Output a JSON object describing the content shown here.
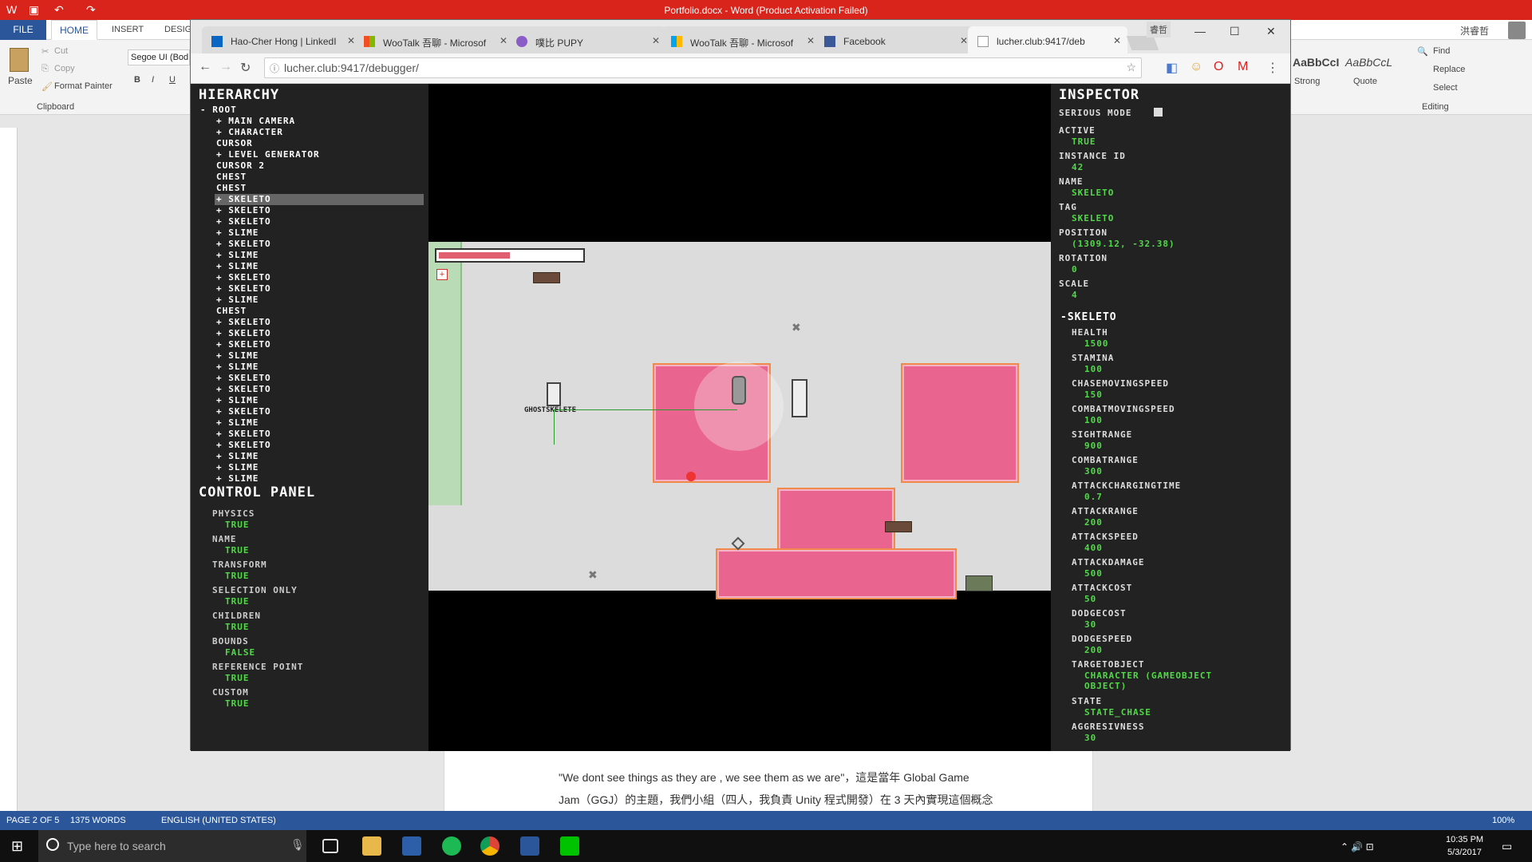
{
  "word": {
    "title": "Portfolio.docx - Word (Product Activation Failed)",
    "tabs": [
      "FILE",
      "HOME",
      "INSERT",
      "DESIG"
    ],
    "clipboard": {
      "paste": "Paste",
      "cut": "Cut",
      "copy": "Copy",
      "format_painter": "Format Painter",
      "group": "Clipboard"
    },
    "font_name": "Segoe UI (Bod",
    "styles": [
      {
        "sample": "AaBbCcI",
        "name": "Strong"
      },
      {
        "sample": "AaBbCcL",
        "name": "Quote"
      }
    ],
    "editing": {
      "find": "Find",
      "replace": "Replace",
      "select": "Select",
      "group": "Editing"
    },
    "user": "洪睿哲",
    "doc_lines": [
      "\"We dont see things as they are , we see them as we are\"，這是當年 Global Game",
      "Jam（GGJ）的主題，我們小組（四人，我負責 Unity 程式開發）在 3 天內實現這個概念"
    ],
    "status": {
      "page": "PAGE 2 OF 5",
      "words": "1375 WORDS",
      "language": "ENGLISH (UNITED STATES)",
      "zoom": "100%"
    }
  },
  "chrome": {
    "tabs": [
      {
        "title": "Hao-Cher Hong | LinkedI",
        "icon": "linkedin-icon"
      },
      {
        "title": "WooTalk 吾聊 - Microsof",
        "icon": "microsoft-icon"
      },
      {
        "title": "噗比 PUPY",
        "icon": "pupy-icon"
      },
      {
        "title": "WooTalk 吾聊 - Microsof",
        "icon": "microsoft-icon"
      },
      {
        "title": "Facebook",
        "icon": "facebook-icon"
      },
      {
        "title": "lucher.club:9417/deb",
        "icon": "page-icon"
      }
    ],
    "profile_label": "睿哲",
    "url": "lucher.club:9417/debugger/"
  },
  "hierarchy": {
    "title": "Hierarchy",
    "root": "- Root",
    "items": [
      {
        "label": "+ Main Camera",
        "selected": false
      },
      {
        "label": "+ Character",
        "selected": false
      },
      {
        "label": "Cursor",
        "selected": false
      },
      {
        "label": "+ Level Generator",
        "selected": false
      },
      {
        "label": "Cursor 2",
        "selected": false
      },
      {
        "label": "Chest",
        "selected": false
      },
      {
        "label": "Chest",
        "selected": false
      },
      {
        "label": "+ Skeleto",
        "selected": true
      },
      {
        "label": "+ Skeleto",
        "selected": false
      },
      {
        "label": "+ Skeleto",
        "selected": false
      },
      {
        "label": "+ Slime",
        "selected": false
      },
      {
        "label": "+ Skeleto",
        "selected": false
      },
      {
        "label": "+ Slime",
        "selected": false
      },
      {
        "label": "+ Slime",
        "selected": false
      },
      {
        "label": "+ Skeleto",
        "selected": false
      },
      {
        "label": "+ Skeleto",
        "selected": false
      },
      {
        "label": "+ Slime",
        "selected": false
      },
      {
        "label": "Chest",
        "selected": false
      },
      {
        "label": "+ Skeleto",
        "selected": false
      },
      {
        "label": "+ Skeleto",
        "selected": false
      },
      {
        "label": "+ Skeleto",
        "selected": false
      },
      {
        "label": "+ Slime",
        "selected": false
      },
      {
        "label": "+ Slime",
        "selected": false
      },
      {
        "label": "+ Skeleto",
        "selected": false
      },
      {
        "label": "+ Skeleto",
        "selected": false
      },
      {
        "label": "+ Slime",
        "selected": false
      },
      {
        "label": "+ Skeleto",
        "selected": false
      },
      {
        "label": "+ Slime",
        "selected": false
      },
      {
        "label": "+ Skeleto",
        "selected": false
      },
      {
        "label": "+ Skeleto",
        "selected": false
      },
      {
        "label": "+ Slime",
        "selected": false
      },
      {
        "label": "+ Slime",
        "selected": false
      },
      {
        "label": "+ Slime",
        "selected": false
      }
    ]
  },
  "control_panel": {
    "title": "Control Panel",
    "items": [
      {
        "label": "Physics",
        "value": "True"
      },
      {
        "label": "Name",
        "value": "True"
      },
      {
        "label": "Transform",
        "value": "True"
      },
      {
        "label": "Selection Only",
        "value": "True"
      },
      {
        "label": "Children",
        "value": "True"
      },
      {
        "label": "Bounds",
        "value": "False"
      },
      {
        "label": "Reference Point",
        "value": "True"
      },
      {
        "label": "Custom",
        "value": "True"
      }
    ]
  },
  "game": {
    "hover_label": "GHOSTSKELETE",
    "health_fraction": 0.5
  },
  "inspector": {
    "title": "Inspector",
    "serious_mode": "Serious Mode",
    "fields": [
      {
        "label": "Active",
        "value": "True"
      },
      {
        "label": "Instance ID",
        "value": "42"
      },
      {
        "label": "Name",
        "value": "Skeleto"
      },
      {
        "label": "Tag",
        "value": "Skeleto"
      },
      {
        "label": "Position",
        "value": "(1309.12, -32.38)"
      },
      {
        "label": "Rotation",
        "value": "0"
      },
      {
        "label": "Scale",
        "value": "4"
      }
    ],
    "component": "-Skeleto",
    "component_fields": [
      {
        "label": "Health",
        "value": "1500"
      },
      {
        "label": "Stamina",
        "value": "100"
      },
      {
        "label": "ChaseMovingSpeed",
        "value": "150"
      },
      {
        "label": "CombatMovingSpeed",
        "value": "100"
      },
      {
        "label": "SightRange",
        "value": "900"
      },
      {
        "label": "CombatRange",
        "value": "300"
      },
      {
        "label": "AttackChargingTime",
        "value": "0.7"
      },
      {
        "label": "AttackRange",
        "value": "200"
      },
      {
        "label": "AttackSpeed",
        "value": "400"
      },
      {
        "label": "AttackDamage",
        "value": "500"
      },
      {
        "label": "AttackCost",
        "value": "50"
      },
      {
        "label": "DodgeCost",
        "value": "30"
      },
      {
        "label": "DodgeSpeed",
        "value": "200"
      },
      {
        "label": "TargetObject",
        "value": "Character (GameObject object)"
      },
      {
        "label": "State",
        "value": "STATE_CHASE"
      },
      {
        "label": "Aggresivness",
        "value": "30"
      }
    ]
  },
  "taskbar": {
    "search_placeholder": "Type here to search",
    "time": "10:35 PM",
    "date": "5/3/2017"
  },
  "colors": {
    "word_red": "#d9241c",
    "word_blue": "#2b579a",
    "debug_green": "#52d84a",
    "floor_pink": "#e9648f"
  }
}
